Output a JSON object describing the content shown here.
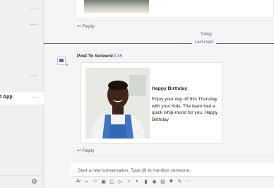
{
  "sidebar": {
    "more_glyph": "···",
    "active_item_label": "t App",
    "settings_icon": "gear-icon"
  },
  "thread": {
    "reply_label": "Reply",
    "today_label": "Today",
    "last_read_label": "Last read"
  },
  "post": {
    "sender": "Post To Screens",
    "time": "20:45",
    "card": {
      "title": "Happy Birthday",
      "body": "Enjoy your day off this Thursday with your Kids. The team had a quick whip-round for you. Happy Birthday"
    }
  },
  "compose": {
    "placeholder": "Start a new conversation. Type @ to mention someone."
  },
  "toolbar_icons": [
    "format-icon",
    "attach-icon",
    "emoji-icon",
    "gif-icon",
    "sticker-icon",
    "meet-icon",
    "praise-icon",
    "stream-icon",
    "loop-icon",
    "poll-icon",
    "approvals-icon",
    "video-icon",
    "whiteboard-icon",
    "more-icon"
  ],
  "colors": {
    "accent": "#6264a7",
    "presence": "#92c353"
  }
}
